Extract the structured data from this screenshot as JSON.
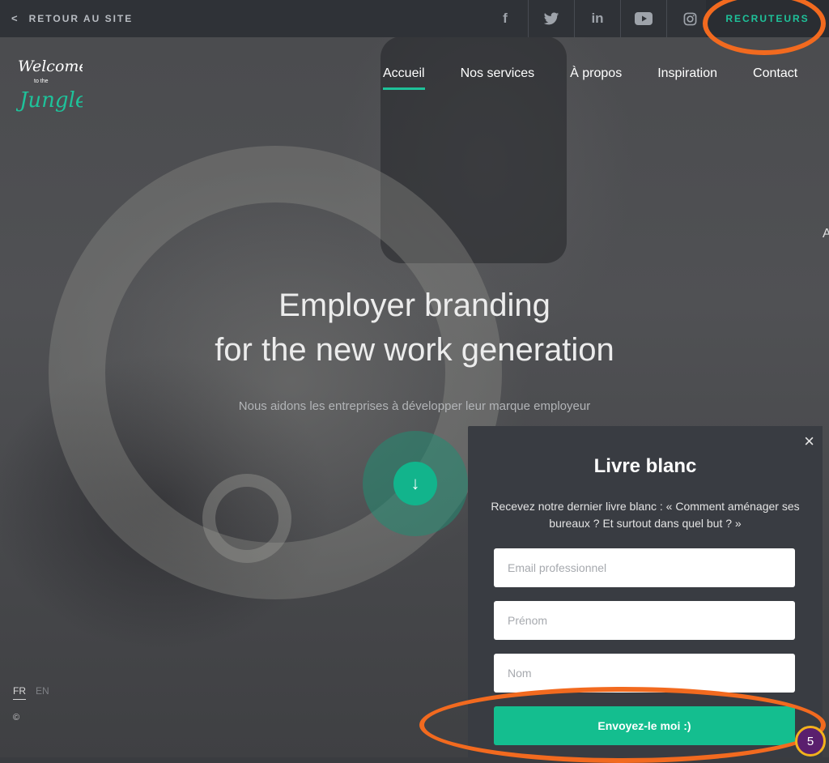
{
  "topbar": {
    "back_label": "RETOUR AU SITE",
    "social_icons": [
      "facebook-icon",
      "twitter-icon",
      "linkedin-icon",
      "youtube-icon",
      "instagram-icon"
    ],
    "recruiters_label": "RECRUTEURS"
  },
  "logo": {
    "line1": "Welcome",
    "line2": "to the",
    "line3": "Jungle"
  },
  "nav": {
    "items": [
      {
        "label": "Accueil",
        "active": true
      },
      {
        "label": "Nos services"
      },
      {
        "label": "À propos"
      },
      {
        "label": "Inspiration"
      },
      {
        "label": "Contact"
      }
    ]
  },
  "hero": {
    "title_line1": "Employer branding",
    "title_line2": "for the new work generation",
    "subtitle": "Nous aidons les entreprises à développer leur marque employeur",
    "scroll_glyph": "↓",
    "edge_letter": "A"
  },
  "language": {
    "fr": "FR",
    "en": "EN",
    "selected": "FR"
  },
  "footer": {
    "copyright": "©"
  },
  "popup": {
    "close_glyph": "×",
    "title": "Livre blanc",
    "text": "Recevez notre dernier livre blanc : « Comment aménager ses bureaux ? Et surtout dans quel but ? »",
    "email_placeholder": "Email professionnel",
    "firstname_placeholder": "Prénom",
    "lastname_placeholder": "Nom",
    "submit_label": "Envoyez-le moi :)"
  },
  "annotation": {
    "step_number": "5"
  },
  "colors": {
    "accent": "#1ec29a",
    "button": "#14be8f",
    "popup_bg": "#393c42",
    "topbar_bg": "#2f3237",
    "annotation": "#f26a1f"
  }
}
